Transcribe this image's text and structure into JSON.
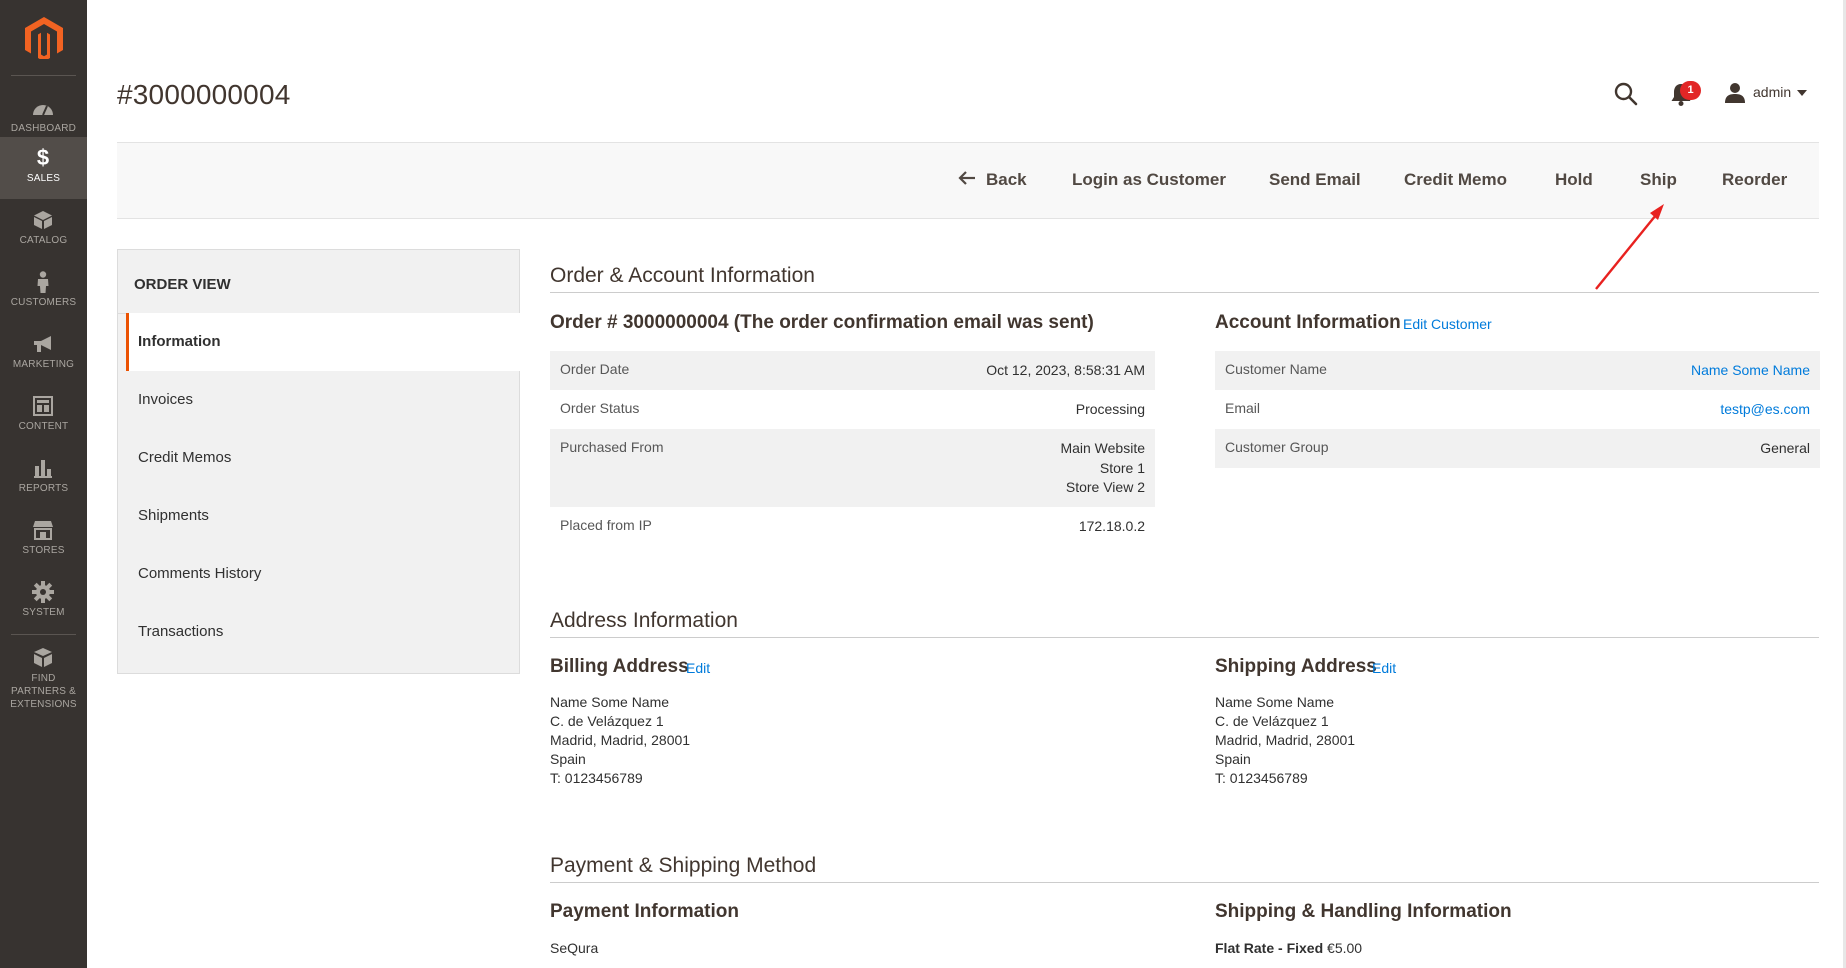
{
  "nav": {
    "items": [
      {
        "label": "DASHBOARD",
        "icon": "dashboard-icon"
      },
      {
        "label": "SALES",
        "icon": "dollar-icon",
        "active": true
      },
      {
        "label": "CATALOG",
        "icon": "box-icon"
      },
      {
        "label": "CUSTOMERS",
        "icon": "person-icon"
      },
      {
        "label": "MARKETING",
        "icon": "megaphone-icon"
      },
      {
        "label": "CONTENT",
        "icon": "layout-icon"
      },
      {
        "label": "REPORTS",
        "icon": "bar-chart-icon"
      },
      {
        "label": "STORES",
        "icon": "storefront-icon"
      },
      {
        "label": "SYSTEM",
        "icon": "gear-icon"
      },
      {
        "label": "FIND PARTNERS & EXTENSIONS",
        "icon": "cubes-icon"
      }
    ]
  },
  "header": {
    "title": "#3000000004",
    "notification_count": "1",
    "user_name": "admin"
  },
  "actions": {
    "back": "Back",
    "login_as_customer": "Login as Customer",
    "send_email": "Send Email",
    "credit_memo": "Credit Memo",
    "hold": "Hold",
    "ship": "Ship",
    "reorder": "Reorder"
  },
  "tabs": {
    "title": "ORDER VIEW",
    "items": [
      "Information",
      "Invoices",
      "Credit Memos",
      "Shipments",
      "Comments History",
      "Transactions"
    ]
  },
  "order_account": {
    "section_title": "Order & Account Information",
    "order_heading": "Order # 3000000004 (The order confirmation email was sent)",
    "order_rows": [
      {
        "label": "Order Date",
        "value": "Oct 12, 2023, 8:58:31 AM"
      },
      {
        "label": "Order Status",
        "value": "Processing"
      },
      {
        "label": "Purchased From",
        "value_lines": [
          "Main Website",
          "Store 1",
          "Store View 2"
        ]
      },
      {
        "label": "Placed from IP",
        "value": "172.18.0.2"
      }
    ],
    "account_heading": "Account Information",
    "edit_customer": "Edit Customer",
    "account_rows": [
      {
        "label": "Customer Name",
        "value": "Name Some Name"
      },
      {
        "label": "Email",
        "value": "testp@es.com"
      },
      {
        "label": "Customer Group",
        "value": "General"
      }
    ]
  },
  "address": {
    "section_title": "Address Information",
    "billing_heading": "Billing Address",
    "shipping_heading": "Shipping Address",
    "edit": "Edit",
    "billing_lines": [
      "Name Some Name",
      "C. de Velázquez 1",
      "Madrid, Madrid, 28001",
      "Spain",
      "T: 0123456789"
    ],
    "shipping_lines": [
      "Name Some Name",
      "C. de Velázquez 1",
      "Madrid, Madrid, 28001",
      "Spain",
      "T: 0123456789"
    ]
  },
  "payment_shipping": {
    "section_title": "Payment & Shipping Method",
    "payment_heading": "Payment Information",
    "payment_method": "SeQura",
    "shipping_heading": "Shipping & Handling Information",
    "shipping_method": "Flat Rate - Fixed",
    "shipping_price": "€5.00"
  },
  "colors": {
    "nav_bg": "#373330",
    "accent": "#eb5202",
    "link": "#007bdb",
    "annotation": "#e8211f"
  }
}
